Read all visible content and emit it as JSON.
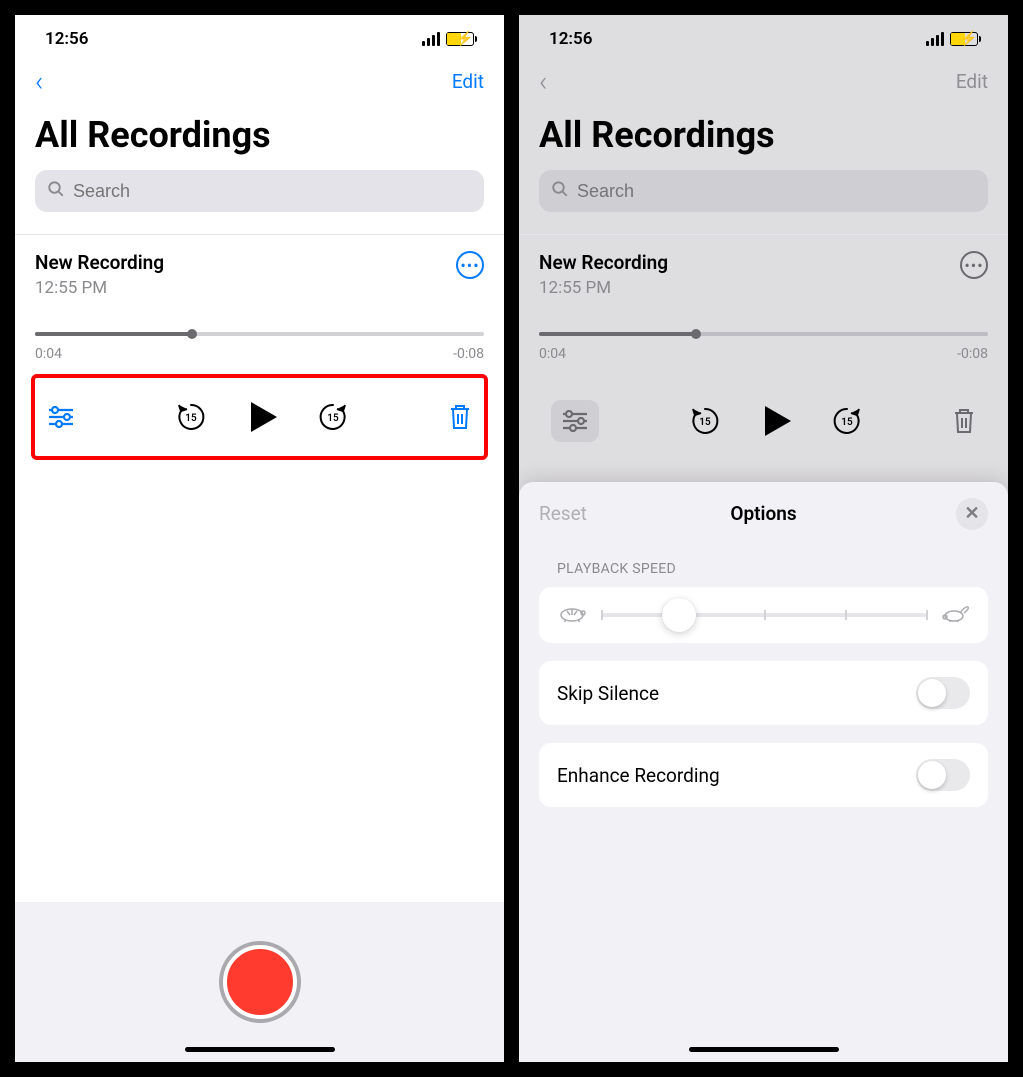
{
  "status": {
    "time": "12:56"
  },
  "nav": {
    "edit": "Edit"
  },
  "header": {
    "title": "All Recordings",
    "search_placeholder": "Search"
  },
  "recording": {
    "title": "New Recording",
    "time": "12:55 PM",
    "elapsed": "0:04",
    "remaining": "-0:08",
    "progress_percent": 35
  },
  "options": {
    "reset": "Reset",
    "title": "Options",
    "speed_label": "PLAYBACK SPEED",
    "skip_silence": "Skip Silence",
    "enhance_recording": "Enhance Recording",
    "speed_knob_percent": 24
  }
}
